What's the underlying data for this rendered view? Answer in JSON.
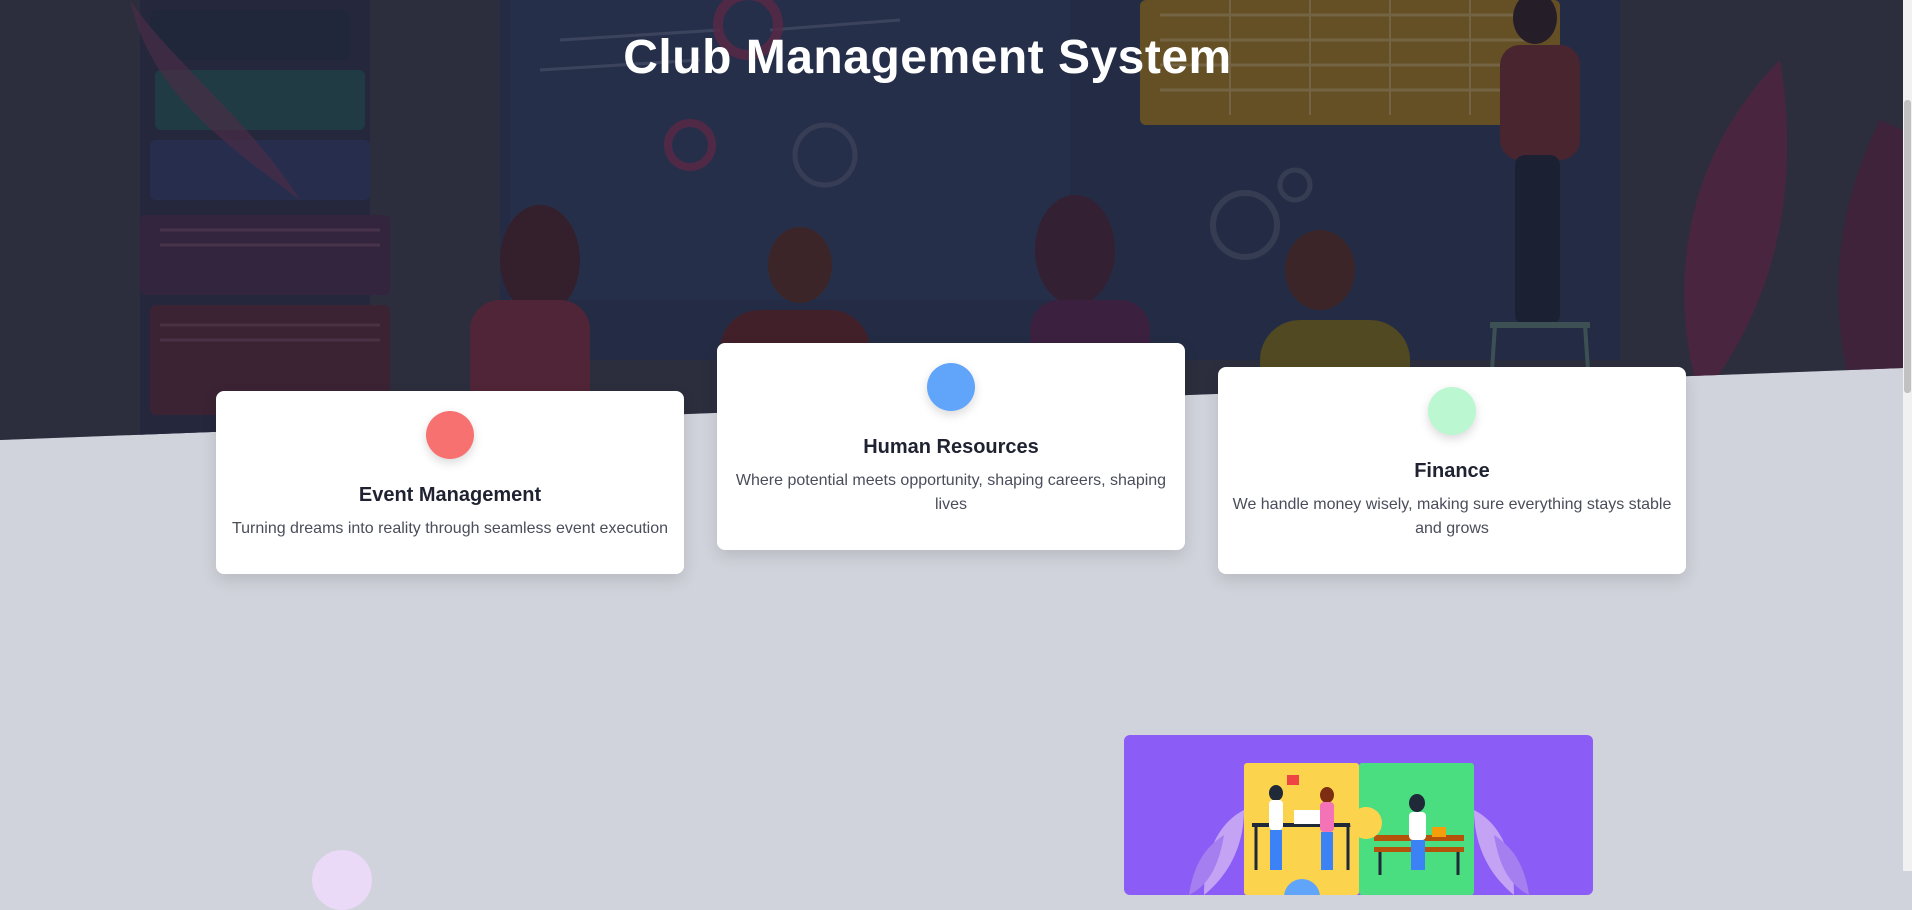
{
  "hero": {
    "title": "Club Management System"
  },
  "cards": [
    {
      "title": "Event Management",
      "description": "Turning dreams into reality through seamless event execution",
      "icon_color": "#f87171"
    },
    {
      "title": "Human Resources",
      "description": "Where potential meets opportunity, shaping careers, shaping lives",
      "icon_color": "#60a5fa"
    },
    {
      "title": "Finance",
      "description": "We handle money wisely, making sure everything stays stable and grows",
      "icon_color": "#bbf7d0"
    }
  ],
  "colors": {
    "page_background": "#d1d3dc",
    "illustration_background": "#8b5cf6",
    "lower_circle": "#ead9f7"
  }
}
